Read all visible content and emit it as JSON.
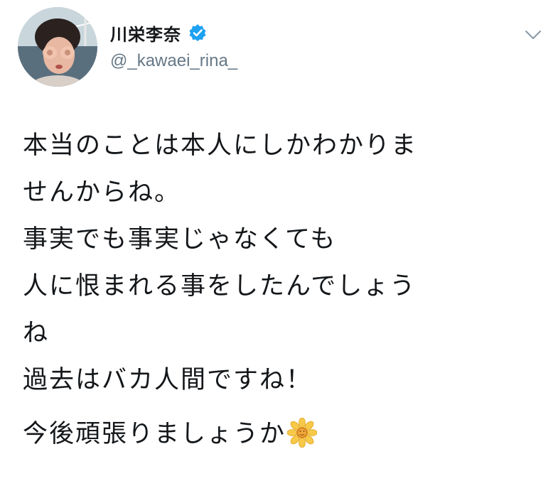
{
  "author": {
    "display_name": "川栄李奈",
    "handle": "@_kawaei_rina_",
    "verified": true,
    "avatar_icon": "profile-photo"
  },
  "menu": {
    "icon": "chevron-down-icon"
  },
  "tweet": {
    "lines": [
      "本当のことは本人にしかわかりま",
      "せんからね。",
      "事実でも事実じゃなくても",
      "人に恨まれる事をしたんでしょう",
      "ね",
      "過去はバカ人間ですね！"
    ],
    "last_line": "今後頑張りましょうか",
    "emoji": "sunflower-emoji"
  },
  "colors": {
    "verified_blue": "#1da1f2",
    "handle_gray": "#657786",
    "text": "#14171a"
  }
}
